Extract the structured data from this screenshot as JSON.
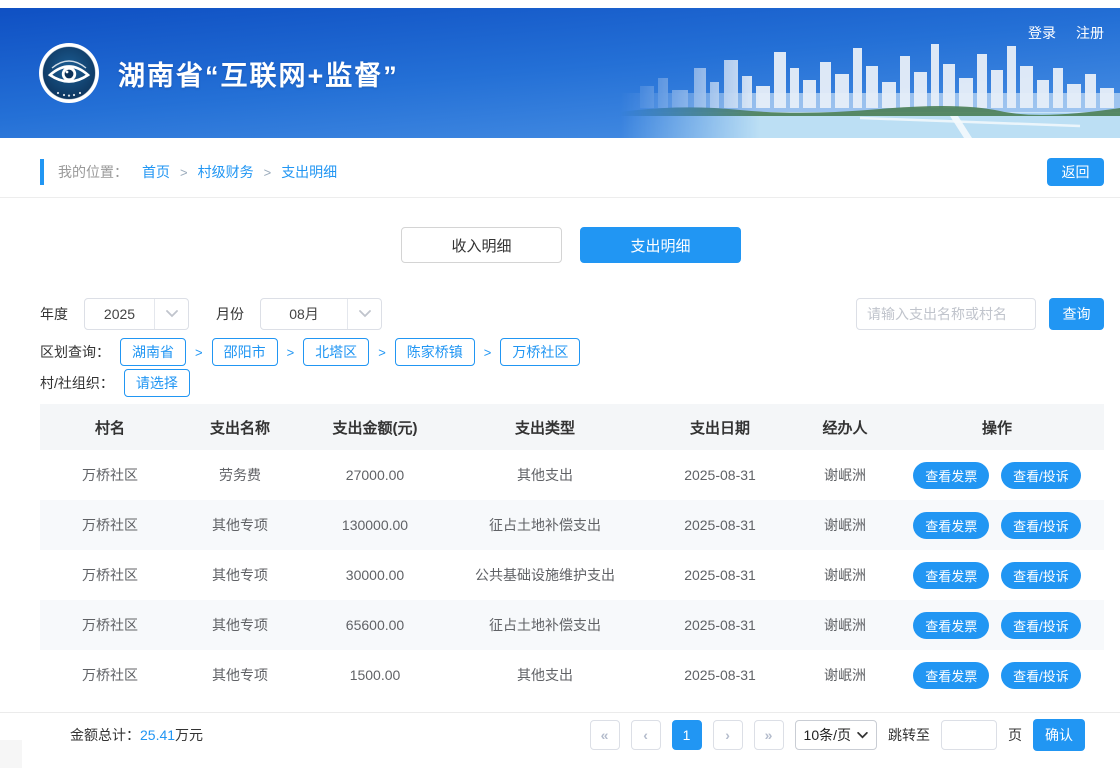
{
  "header": {
    "title": "湖南省“互联网+监督”",
    "login_label": "登录",
    "register_label": "注册"
  },
  "breadcrumb": {
    "label": "我的位置：",
    "items": [
      "首页",
      "村级财务",
      "支出明细"
    ],
    "separator": ">",
    "back_label": "返回"
  },
  "tabs": {
    "income_label": "收入明细",
    "expense_label": "支出明细"
  },
  "filters": {
    "year_label": "年度",
    "year_value": "2025",
    "month_label": "月份",
    "month_value": "08月",
    "search_placeholder": "请输入支出名称或村名",
    "query_label": "查询",
    "region_label": "区划查询：",
    "region_separator": ">",
    "regions": [
      "湖南省",
      "邵阳市",
      "北塔区",
      "陈家桥镇",
      "万桥社区"
    ],
    "org_label": "村/社组织：",
    "org_value": "请选择"
  },
  "table": {
    "headers": [
      "村名",
      "支出名称",
      "支出金额(元)",
      "支出类型",
      "支出日期",
      "经办人",
      "操作"
    ],
    "action_invoice": "查看发票",
    "action_complain": "查看/投诉",
    "rows": [
      {
        "village": "万桥社区",
        "name": "劳务费",
        "amount": "27000.00",
        "type": "其他支出",
        "date": "2025-08-31",
        "agent": "谢岷洲"
      },
      {
        "village": "万桥社区",
        "name": "其他专项",
        "amount": "130000.00",
        "type": "征占土地补偿支出",
        "date": "2025-08-31",
        "agent": "谢岷洲"
      },
      {
        "village": "万桥社区",
        "name": "其他专项",
        "amount": "30000.00",
        "type": "公共基础设施维护支出",
        "date": "2025-08-31",
        "agent": "谢岷洲"
      },
      {
        "village": "万桥社区",
        "name": "其他专项",
        "amount": "65600.00",
        "type": "征占土地补偿支出",
        "date": "2025-08-31",
        "agent": "谢岷洲"
      },
      {
        "village": "万桥社区",
        "name": "其他专项",
        "amount": "1500.00",
        "type": "其他支出",
        "date": "2025-08-31",
        "agent": "谢岷洲"
      }
    ]
  },
  "footer": {
    "total_label": "金额总计：",
    "total_value": "25.41",
    "total_unit": "万元",
    "pagination": {
      "first": "«",
      "prev": "‹",
      "current_page": "1",
      "next": "›",
      "last": "»"
    },
    "page_size_value": "10条/页",
    "jump_label": "跳转至",
    "page_unit_label": "页",
    "confirm_label": "确认"
  },
  "colors": {
    "primary_blue": "#2196f3",
    "amount_red": "#f6705a",
    "header_gradient_top": "#0f50c3",
    "header_gradient_bottom": "#4f95e6"
  }
}
